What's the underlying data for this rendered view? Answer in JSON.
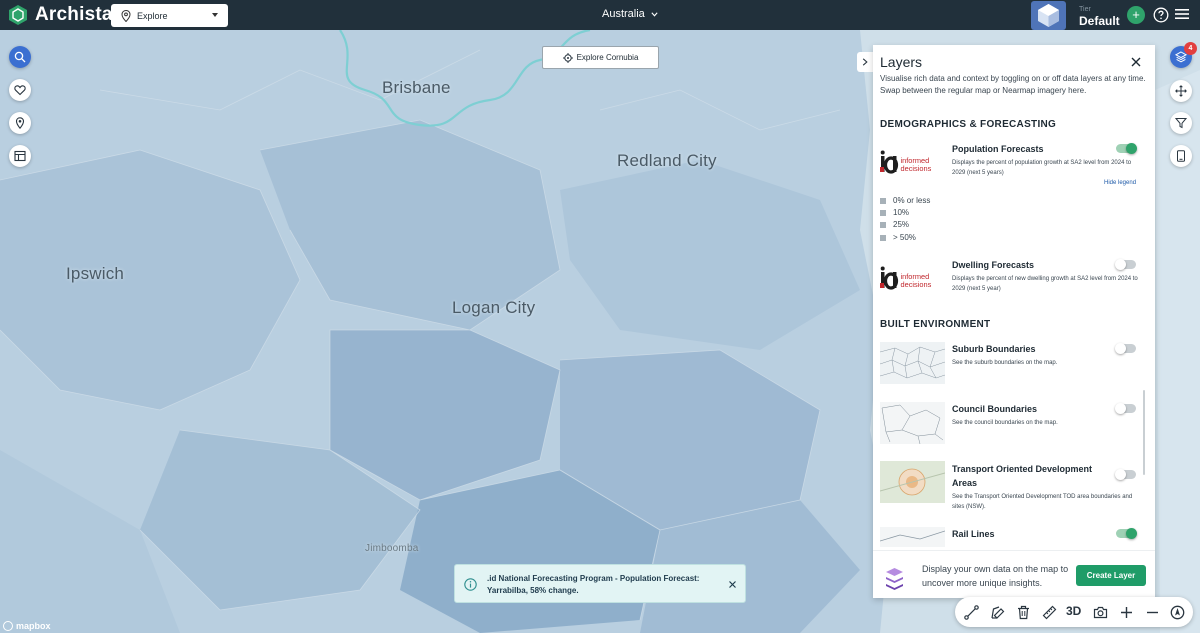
{
  "app": {
    "name": "Archistar"
  },
  "topbar": {
    "mode_label": "Explore",
    "region_label": "Australia",
    "tier_label": "Tier",
    "tier_value": "Default"
  },
  "map": {
    "labels": {
      "brisbane": "Brisbane",
      "redland": "Redland City",
      "ipswich": "Ipswich",
      "logan": "Logan City",
      "jimboomba": "Jimboomba"
    },
    "attribution": "mapbox"
  },
  "explore_button": {
    "label": "Explore Cornubia"
  },
  "right_tools": {
    "layers_badge": "4"
  },
  "layers_panel": {
    "title": "Layers",
    "description": "Visualise rich data and context by toggling on or off data layers at any time. Swap between the regular map or Nearmap imagery here.",
    "sections": {
      "demographics": "Demographics & Forecasting",
      "built": "Built Environment"
    },
    "layers": {
      "population": {
        "name": "Population Forecasts",
        "desc": "Displays the percent of population growth at SA2 level from 2024 to 2029 (next 5 years)",
        "enabled": true
      },
      "dwelling": {
        "name": "Dwelling Forecasts",
        "desc": "Displays the percent of new dwelling growth at SA2 level from 2024 to 2029 (next 5 year)",
        "enabled": false
      },
      "suburb": {
        "name": "Suburb Boundaries",
        "desc": "See the suburb boundaries on the map.",
        "enabled": false
      },
      "council": {
        "name": "Council Boundaries",
        "desc": "See the council boundaries on the map.",
        "enabled": false
      },
      "tod": {
        "name": "Transport Oriented Development Areas",
        "desc": "See the Transport Oriented Development TOD area boundaries and sites (NSW).",
        "enabled": false
      },
      "rail": {
        "name": "Rail Lines",
        "enabled": true
      }
    },
    "legend_toggle": "Hide legend",
    "legend": [
      "0% or less",
      "10%",
      "25%",
      "> 50%"
    ],
    "thumb_brand": [
      "informed",
      "decisions"
    ],
    "footer": {
      "text": "Display your own data on the map to uncover more unique insights.",
      "create_label": "Create Layer"
    }
  },
  "toast": {
    "text": ".id National Forecasting Program - Population Forecast: Yarrabilba, 58% change."
  },
  "bottombar": {
    "threed_label": "3D"
  },
  "colors": {
    "topbar": "#21303b",
    "accent_green": "#1f9c68",
    "accent_blue": "#3b6fd1",
    "map_base": "#b9cfe0"
  }
}
